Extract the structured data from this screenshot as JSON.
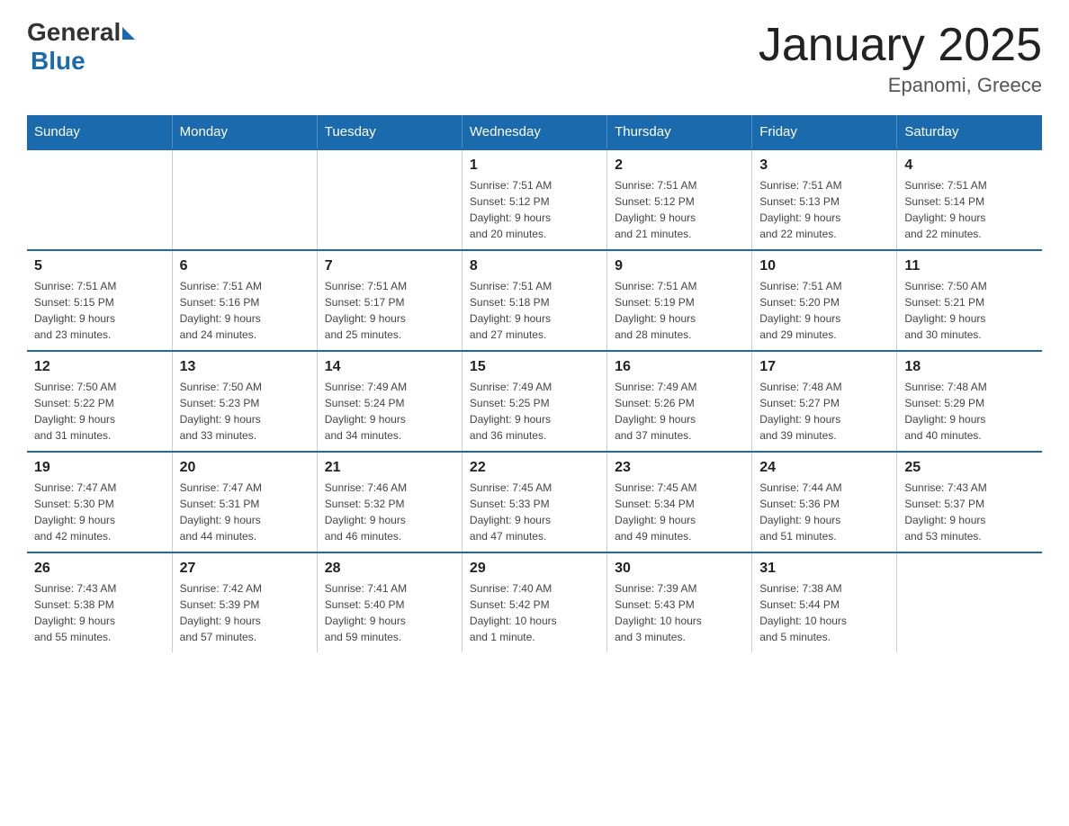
{
  "logo": {
    "general": "General",
    "blue": "Blue"
  },
  "title": "January 2025",
  "subtitle": "Epanomi, Greece",
  "days_of_week": [
    "Sunday",
    "Monday",
    "Tuesday",
    "Wednesday",
    "Thursday",
    "Friday",
    "Saturday"
  ],
  "weeks": [
    [
      {
        "day": "",
        "info": ""
      },
      {
        "day": "",
        "info": ""
      },
      {
        "day": "",
        "info": ""
      },
      {
        "day": "1",
        "info": "Sunrise: 7:51 AM\nSunset: 5:12 PM\nDaylight: 9 hours\nand 20 minutes."
      },
      {
        "day": "2",
        "info": "Sunrise: 7:51 AM\nSunset: 5:12 PM\nDaylight: 9 hours\nand 21 minutes."
      },
      {
        "day": "3",
        "info": "Sunrise: 7:51 AM\nSunset: 5:13 PM\nDaylight: 9 hours\nand 22 minutes."
      },
      {
        "day": "4",
        "info": "Sunrise: 7:51 AM\nSunset: 5:14 PM\nDaylight: 9 hours\nand 22 minutes."
      }
    ],
    [
      {
        "day": "5",
        "info": "Sunrise: 7:51 AM\nSunset: 5:15 PM\nDaylight: 9 hours\nand 23 minutes."
      },
      {
        "day": "6",
        "info": "Sunrise: 7:51 AM\nSunset: 5:16 PM\nDaylight: 9 hours\nand 24 minutes."
      },
      {
        "day": "7",
        "info": "Sunrise: 7:51 AM\nSunset: 5:17 PM\nDaylight: 9 hours\nand 25 minutes."
      },
      {
        "day": "8",
        "info": "Sunrise: 7:51 AM\nSunset: 5:18 PM\nDaylight: 9 hours\nand 27 minutes."
      },
      {
        "day": "9",
        "info": "Sunrise: 7:51 AM\nSunset: 5:19 PM\nDaylight: 9 hours\nand 28 minutes."
      },
      {
        "day": "10",
        "info": "Sunrise: 7:51 AM\nSunset: 5:20 PM\nDaylight: 9 hours\nand 29 minutes."
      },
      {
        "day": "11",
        "info": "Sunrise: 7:50 AM\nSunset: 5:21 PM\nDaylight: 9 hours\nand 30 minutes."
      }
    ],
    [
      {
        "day": "12",
        "info": "Sunrise: 7:50 AM\nSunset: 5:22 PM\nDaylight: 9 hours\nand 31 minutes."
      },
      {
        "day": "13",
        "info": "Sunrise: 7:50 AM\nSunset: 5:23 PM\nDaylight: 9 hours\nand 33 minutes."
      },
      {
        "day": "14",
        "info": "Sunrise: 7:49 AM\nSunset: 5:24 PM\nDaylight: 9 hours\nand 34 minutes."
      },
      {
        "day": "15",
        "info": "Sunrise: 7:49 AM\nSunset: 5:25 PM\nDaylight: 9 hours\nand 36 minutes."
      },
      {
        "day": "16",
        "info": "Sunrise: 7:49 AM\nSunset: 5:26 PM\nDaylight: 9 hours\nand 37 minutes."
      },
      {
        "day": "17",
        "info": "Sunrise: 7:48 AM\nSunset: 5:27 PM\nDaylight: 9 hours\nand 39 minutes."
      },
      {
        "day": "18",
        "info": "Sunrise: 7:48 AM\nSunset: 5:29 PM\nDaylight: 9 hours\nand 40 minutes."
      }
    ],
    [
      {
        "day": "19",
        "info": "Sunrise: 7:47 AM\nSunset: 5:30 PM\nDaylight: 9 hours\nand 42 minutes."
      },
      {
        "day": "20",
        "info": "Sunrise: 7:47 AM\nSunset: 5:31 PM\nDaylight: 9 hours\nand 44 minutes."
      },
      {
        "day": "21",
        "info": "Sunrise: 7:46 AM\nSunset: 5:32 PM\nDaylight: 9 hours\nand 46 minutes."
      },
      {
        "day": "22",
        "info": "Sunrise: 7:45 AM\nSunset: 5:33 PM\nDaylight: 9 hours\nand 47 minutes."
      },
      {
        "day": "23",
        "info": "Sunrise: 7:45 AM\nSunset: 5:34 PM\nDaylight: 9 hours\nand 49 minutes."
      },
      {
        "day": "24",
        "info": "Sunrise: 7:44 AM\nSunset: 5:36 PM\nDaylight: 9 hours\nand 51 minutes."
      },
      {
        "day": "25",
        "info": "Sunrise: 7:43 AM\nSunset: 5:37 PM\nDaylight: 9 hours\nand 53 minutes."
      }
    ],
    [
      {
        "day": "26",
        "info": "Sunrise: 7:43 AM\nSunset: 5:38 PM\nDaylight: 9 hours\nand 55 minutes."
      },
      {
        "day": "27",
        "info": "Sunrise: 7:42 AM\nSunset: 5:39 PM\nDaylight: 9 hours\nand 57 minutes."
      },
      {
        "day": "28",
        "info": "Sunrise: 7:41 AM\nSunset: 5:40 PM\nDaylight: 9 hours\nand 59 minutes."
      },
      {
        "day": "29",
        "info": "Sunrise: 7:40 AM\nSunset: 5:42 PM\nDaylight: 10 hours\nand 1 minute."
      },
      {
        "day": "30",
        "info": "Sunrise: 7:39 AM\nSunset: 5:43 PM\nDaylight: 10 hours\nand 3 minutes."
      },
      {
        "day": "31",
        "info": "Sunrise: 7:38 AM\nSunset: 5:44 PM\nDaylight: 10 hours\nand 5 minutes."
      },
      {
        "day": "",
        "info": ""
      }
    ]
  ],
  "colors": {
    "header_bg": "#1a6aad",
    "border": "#1a6aad"
  }
}
